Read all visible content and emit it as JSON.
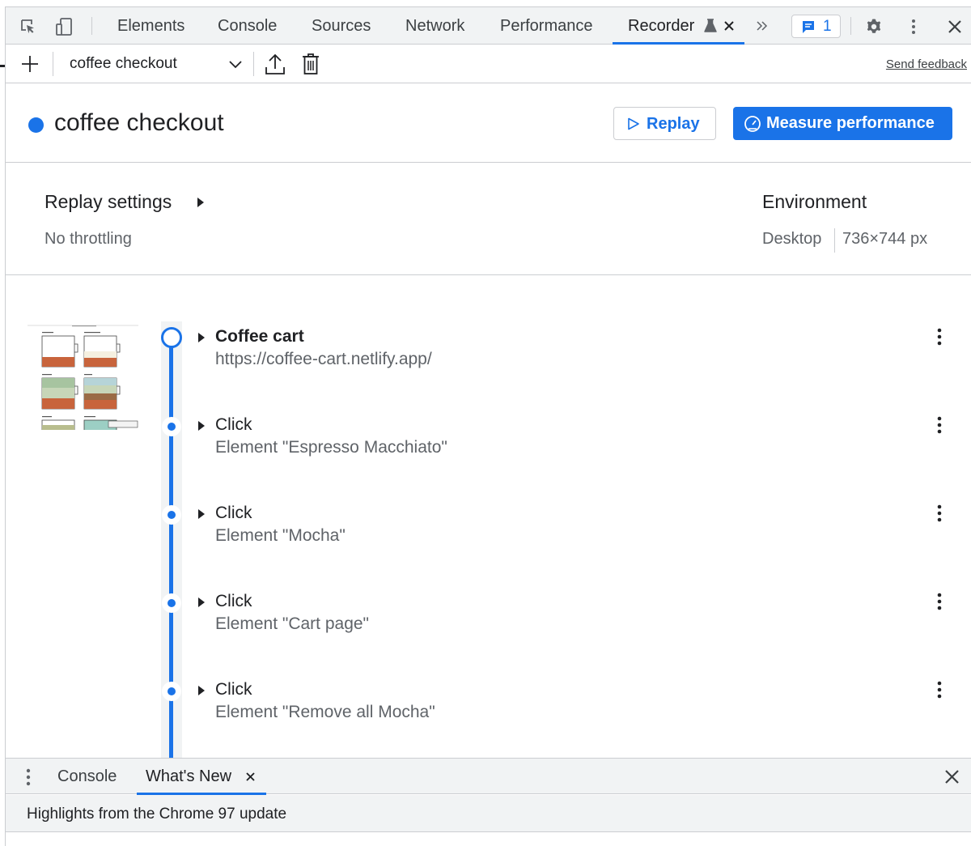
{
  "devtools": {
    "tabs": [
      "Elements",
      "Console",
      "Sources",
      "Network",
      "Performance",
      "Recorder"
    ],
    "active_tab": "Recorder",
    "issues_count": "1"
  },
  "toolbar": {
    "recording_select": "coffee checkout",
    "send_feedback": "Send feedback"
  },
  "recording": {
    "title": "coffee checkout",
    "replay_label": "Replay",
    "measure_label": "Measure performance"
  },
  "replay_settings": {
    "title": "Replay settings",
    "throttling": "No throttling"
  },
  "environment": {
    "title": "Environment",
    "device": "Desktop",
    "size": "736×744 px"
  },
  "steps": [
    {
      "title": "Coffee cart",
      "subtitle": "https://coffee-cart.netlify.app/"
    },
    {
      "title": "Click",
      "subtitle": "Element \"Espresso Macchiato\""
    },
    {
      "title": "Click",
      "subtitle": "Element \"Mocha\""
    },
    {
      "title": "Click",
      "subtitle": "Element \"Cart page\""
    },
    {
      "title": "Click",
      "subtitle": "Element \"Remove all Mocha\""
    }
  ],
  "drawer": {
    "tabs": [
      "Console",
      "What's New"
    ],
    "active_tab": "What's New",
    "highlights": "Highlights from the Chrome 97 update"
  },
  "colors": {
    "accent": "#1a73e8",
    "toolbar_bg": "#f1f3f4",
    "border": "#cbcdd1"
  }
}
